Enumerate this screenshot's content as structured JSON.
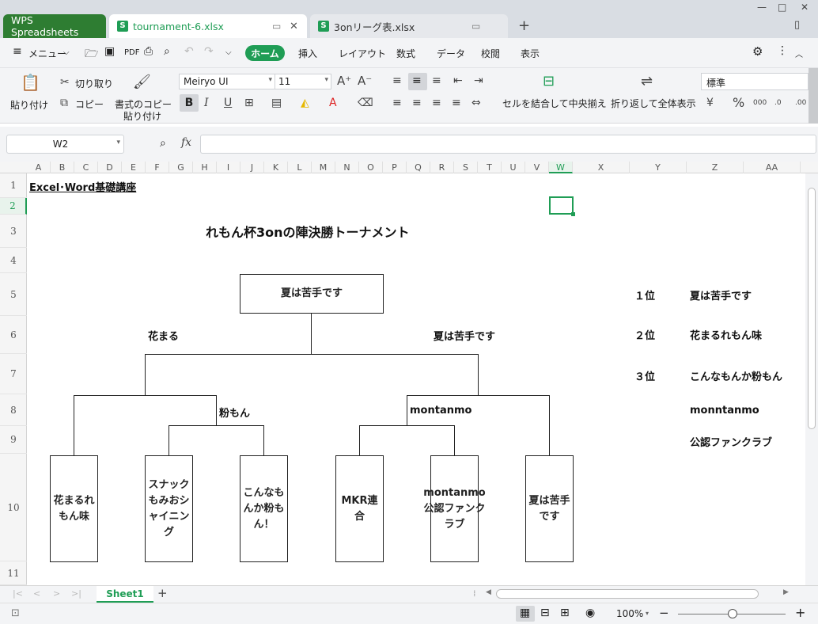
{
  "window": {
    "app_tab": "WPS Spreadsheets",
    "tabs": [
      {
        "label": "tournament-6.xlsx",
        "active": true
      },
      {
        "label": "3onリーグ表.xlsx",
        "active": false
      }
    ],
    "new_tab": "+",
    "controls": {
      "minimize": "—",
      "maximize": "□",
      "close": "✕"
    }
  },
  "menubar": {
    "menu": "メニュー",
    "tabs": [
      "ホーム",
      "挿入",
      "レイアウト",
      "数式",
      "データ",
      "校閲",
      "表示"
    ],
    "active_tab": "ホーム"
  },
  "ribbon": {
    "paste": "貼り付け",
    "cut": "切り取り",
    "copy": "コピー",
    "format_painter_1": "書式のコピー",
    "format_painter_2": "貼り付け",
    "font_name": "Meiryo UI",
    "font_size": "11",
    "bold": "B",
    "italic": "I",
    "underline": "U",
    "merge_center": "セルを結合して中央揃え",
    "wrap_text": "折り返して全体表示",
    "number_format": "標準"
  },
  "formula_bar": {
    "name_box": "W2",
    "fx": "fx",
    "formula": ""
  },
  "columns": [
    "A",
    "B",
    "C",
    "D",
    "E",
    "F",
    "G",
    "H",
    "I",
    "J",
    "K",
    "L",
    "M",
    "N",
    "O",
    "P",
    "Q",
    "R",
    "S",
    "T",
    "U",
    "V",
    "W",
    "X",
    "Y",
    "Z",
    "AA"
  ],
  "rows": [
    "1",
    "2",
    "3",
    "4",
    "5",
    "6",
    "7",
    "8",
    "9",
    "10",
    "11"
  ],
  "sheet": {
    "header": "Excel･Word基礎講座",
    "title": "れもん杯3onの陣決勝トーナメント",
    "winner_box": "夏は苦手です",
    "left_semifinal_winner": "花まる",
    "right_semifinal_winner": "夏は苦手です",
    "left_quarter_winner": "粉もん",
    "right_quarter_winner": "montanmo",
    "teams": [
      "花まるれもん味",
      "スナックもみおシャイニング",
      "こんなもんか粉もん！",
      "MKR連合",
      "montanmo公認ファンクラブ",
      "夏は苦手です"
    ],
    "rankings": [
      {
        "rank": "１位",
        "team": "夏は苦手です"
      },
      {
        "rank": "２位",
        "team": "花まるれもん味"
      },
      {
        "rank": "３位",
        "team": "こんなもんか粉もん"
      },
      {
        "rank": "",
        "team": "monntanmo"
      },
      {
        "rank": "",
        "team": "公認ファンクラブ"
      }
    ]
  },
  "sheet_tabs": {
    "active": "Sheet1",
    "add": "+"
  },
  "status": {
    "zoom": "100%",
    "minus": "−",
    "plus": "+"
  },
  "colors": {
    "accent_green": "#1f9d55",
    "app_tab_green": "#2e7d32"
  }
}
